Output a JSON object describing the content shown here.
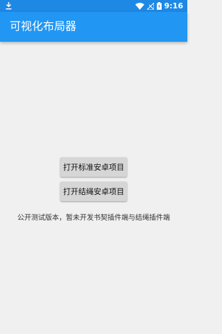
{
  "status_bar": {
    "time": "9:16",
    "icons": [
      "download-icon",
      "wifi-icon",
      "signal-icon",
      "battery-icon"
    ]
  },
  "app_bar": {
    "title": "可视化布局器"
  },
  "main": {
    "buttons": [
      {
        "label": "打开标准安卓项目"
      },
      {
        "label": "打开结绳安卓项目"
      }
    ],
    "note": "公开测试版本，暂未开发书契插件端与结绳插件端"
  },
  "colors": {
    "primary": "#2196f3",
    "status_bar": "#1e88e5",
    "background": "#f0f0f0",
    "button": "#d6d6d6"
  }
}
